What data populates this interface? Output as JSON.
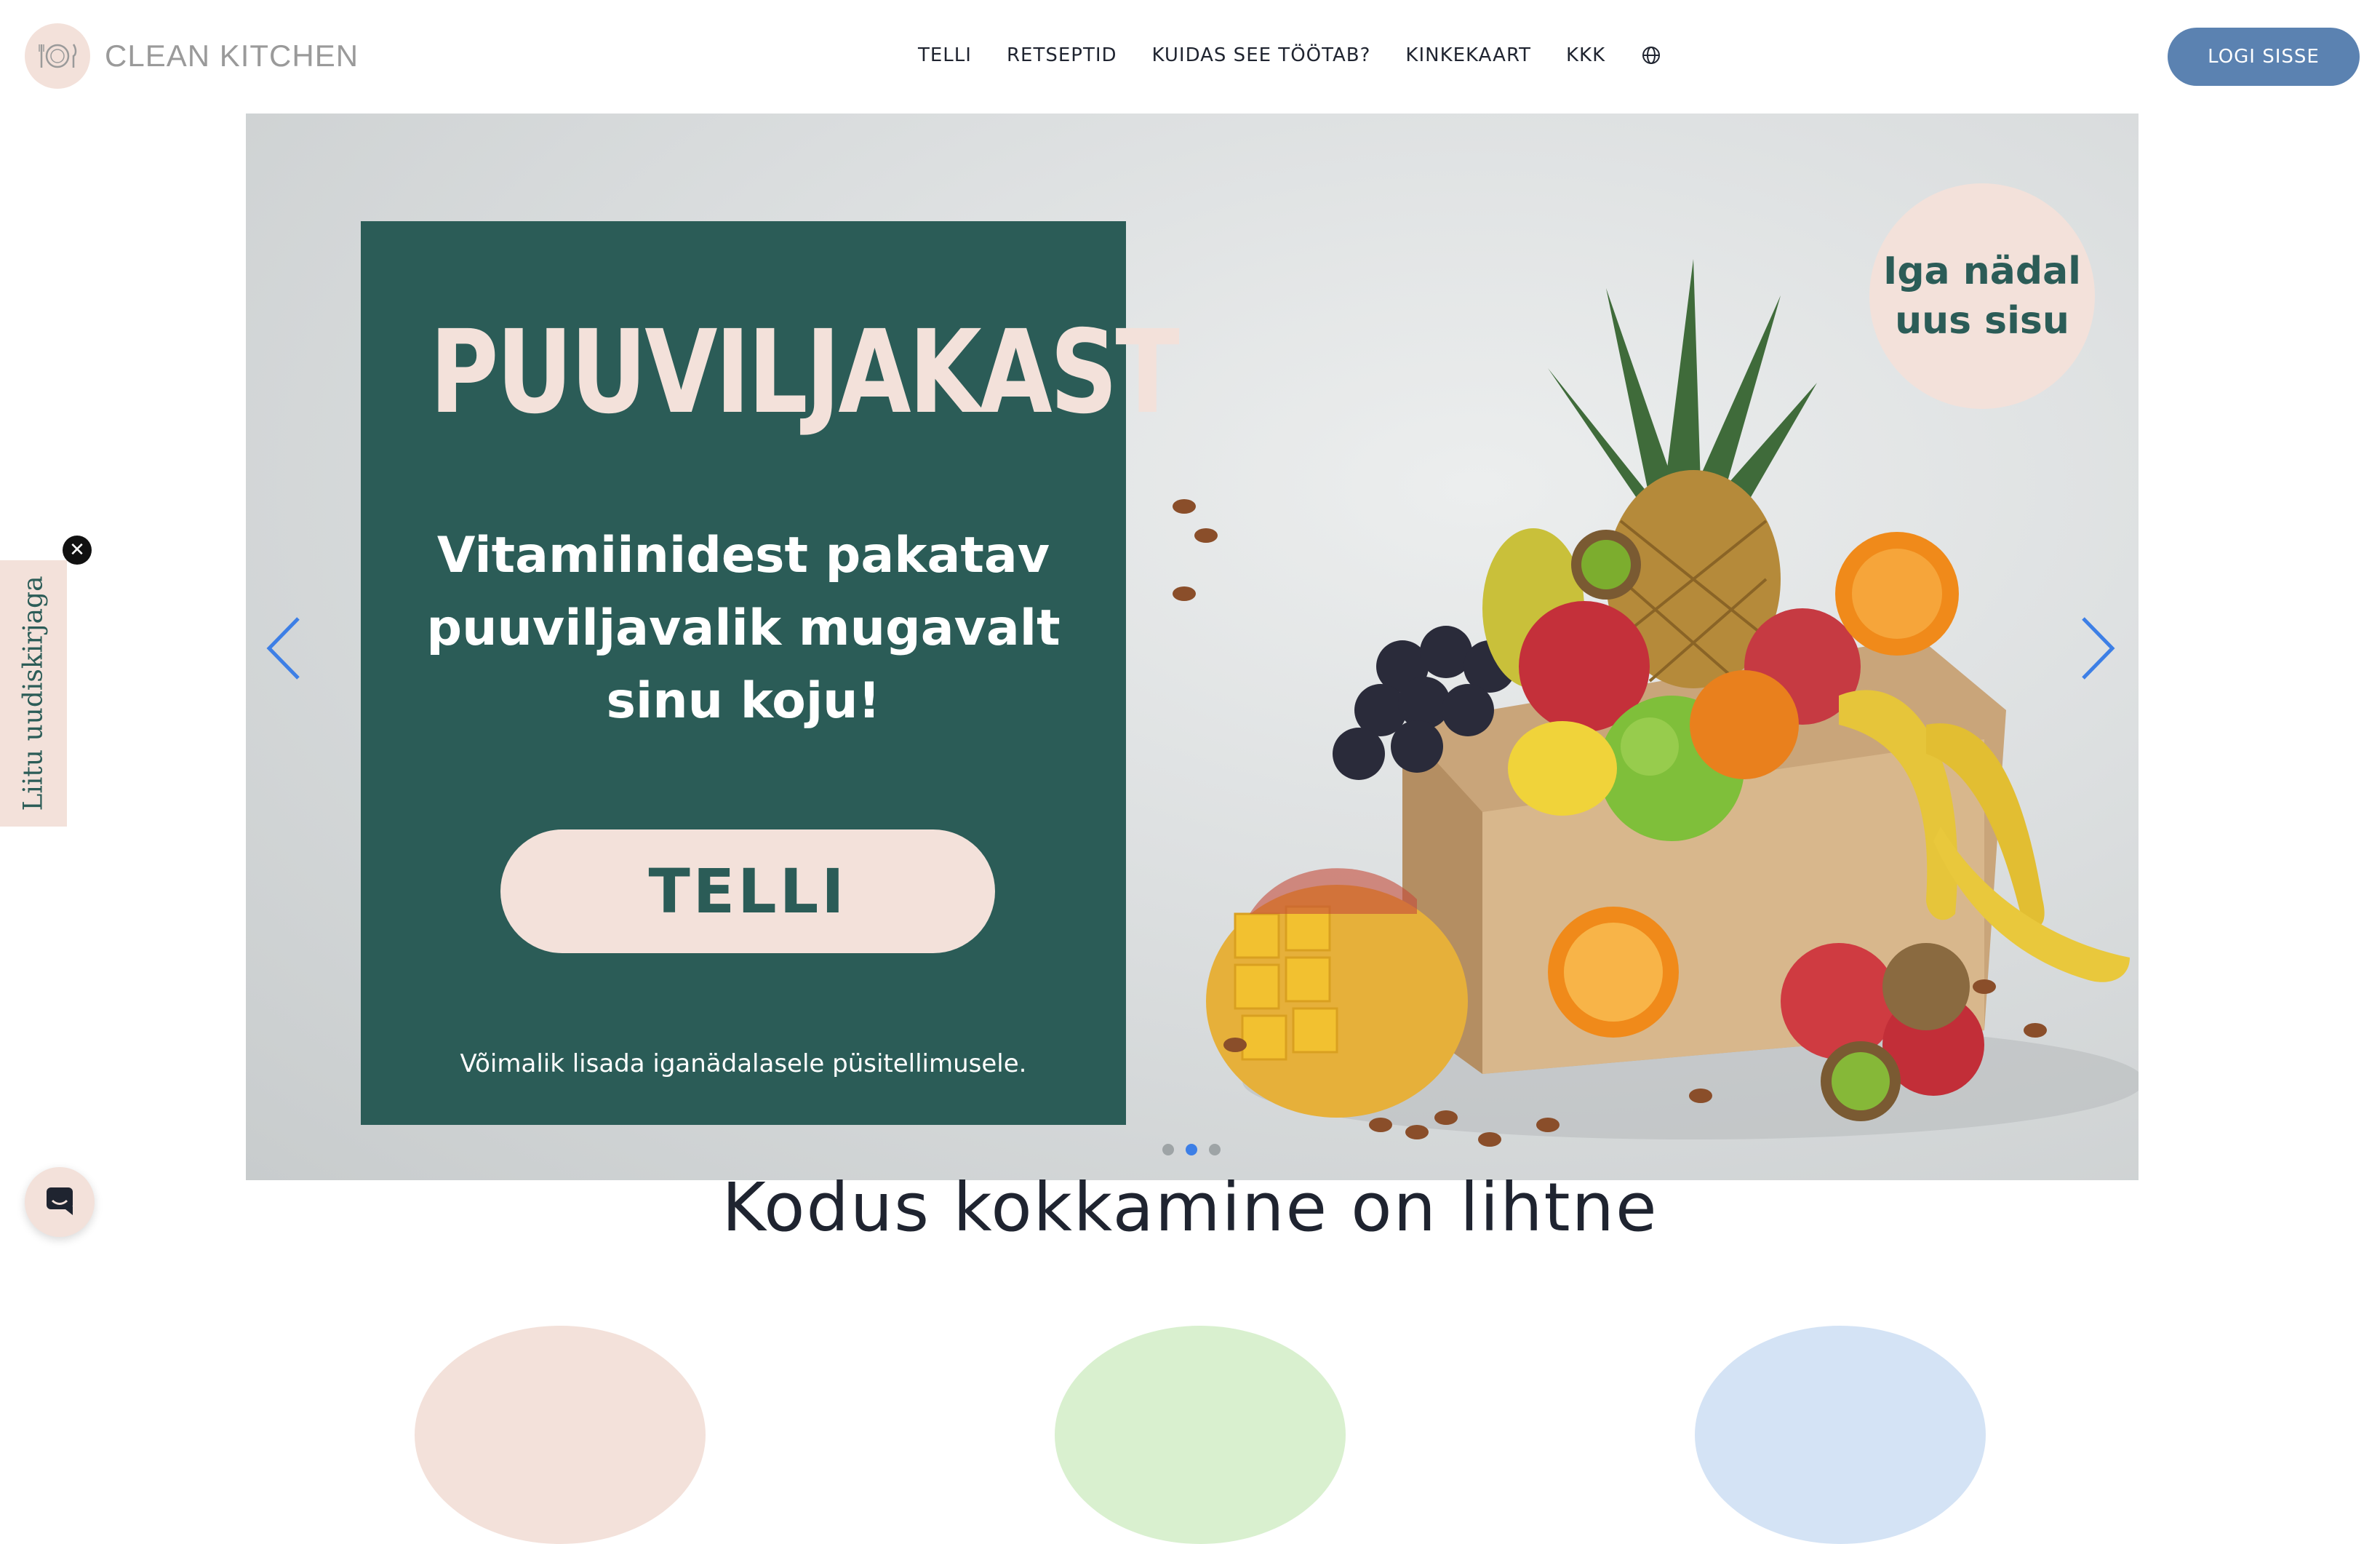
{
  "brand": {
    "name": "CLEAN KITCHEN",
    "logo_icon": "plate-cutlery-icon"
  },
  "nav": {
    "items": [
      {
        "label": "TELLI"
      },
      {
        "label": "RETSEPTID"
      },
      {
        "label": "KUIDAS SEE TÖÖTAB?"
      },
      {
        "label": "KINKEKAART"
      },
      {
        "label": "KKK"
      }
    ],
    "language_icon": "globe-icon",
    "login_label": "LOGI SISSE"
  },
  "hero": {
    "title": "PUUVILJAKAST",
    "subtitle": "Vitamiinidest pakatav puuviljavalik mugavalt sinu koju!",
    "cta_label": "TELLI",
    "note": "Võimalik lisada iganädalasele püsitellimusele.",
    "badge_line1": "Iga nädal",
    "badge_line2": "uus sisu",
    "slide_count": 3,
    "active_slide": 2,
    "prev_icon": "chevron-left-icon",
    "next_icon": "chevron-right-icon"
  },
  "newsletter": {
    "label": "Liitu uudiskirjaga",
    "close_icon": "close-icon"
  },
  "chat": {
    "icon": "chat-icon"
  },
  "section": {
    "title": "Kodus kokkamine on lihtne"
  },
  "colors": {
    "panel": "#2b5c57",
    "cream": "#f3e1da",
    "button": "#5b82b1",
    "dot_active": "#3d7fe6",
    "feature_pink": "#f3e1da",
    "feature_green": "#d9f0cf",
    "feature_blue": "#d4e3f5"
  }
}
